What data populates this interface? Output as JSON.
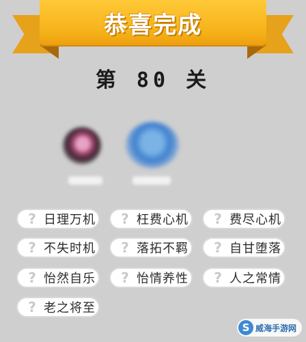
{
  "banner": {
    "title": "恭喜完成"
  },
  "level": {
    "label": "第 80 关"
  },
  "idioms": [
    {
      "mark": "?",
      "text": "日理万机"
    },
    {
      "mark": "?",
      "text": "枉费心机"
    },
    {
      "mark": "?",
      "text": "费尽心机"
    },
    {
      "mark": "?",
      "text": "不失时机"
    },
    {
      "mark": "?",
      "text": "落拓不羁"
    },
    {
      "mark": "?",
      "text": "自甘堕落"
    },
    {
      "mark": "?",
      "text": "怡然自乐"
    },
    {
      "mark": "?",
      "text": "怡情养性"
    },
    {
      "mark": "?",
      "text": "人之常情"
    },
    {
      "mark": "?",
      "text": "老之将至"
    }
  ],
  "watermark": {
    "logo_letter": "S",
    "text": "威海手游网"
  }
}
